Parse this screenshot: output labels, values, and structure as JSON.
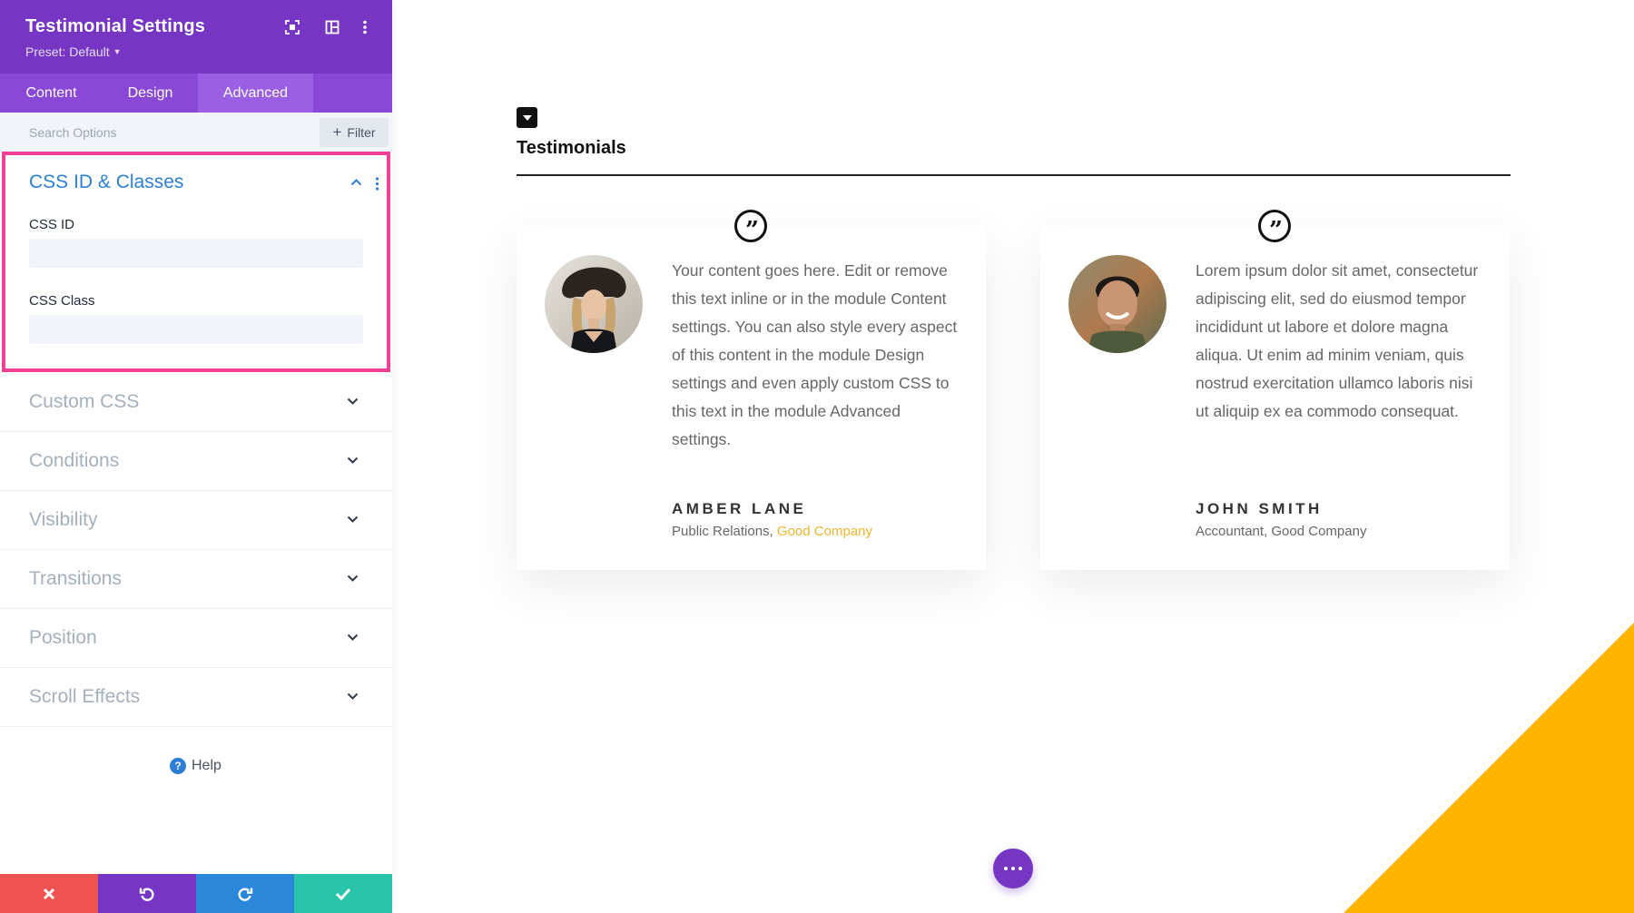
{
  "panel": {
    "title": "Testimonial Settings",
    "preset_label": "Preset: Default",
    "tabs": [
      {
        "label": "Content"
      },
      {
        "label": "Design"
      },
      {
        "label": "Advanced"
      }
    ],
    "active_tab": "Advanced",
    "search": {
      "placeholder": "Search Options",
      "value": ""
    },
    "filter_label": "Filter",
    "open_section": {
      "title": "CSS ID & Classes",
      "fields": [
        {
          "label": "CSS ID",
          "value": ""
        },
        {
          "label": "CSS Class",
          "value": ""
        }
      ]
    },
    "sections": [
      {
        "title": "Custom CSS"
      },
      {
        "title": "Conditions"
      },
      {
        "title": "Visibility"
      },
      {
        "title": "Transitions"
      },
      {
        "title": "Position"
      },
      {
        "title": "Scroll Effects"
      }
    ],
    "help_label": "Help",
    "icons": {
      "focus": "focus-mode-icon",
      "layout": "split-view-icon",
      "more": "more-vertical-icon"
    },
    "colors": {
      "header": "#7636c3",
      "tabs": "#8a48d6",
      "highlight_border": "#ef3f97",
      "accent_blue": "#2c7ed6",
      "cancel": "#ef5350",
      "undo": "#7636c3",
      "redo": "#2b87da",
      "save": "#29c4a9"
    }
  },
  "canvas": {
    "heading": "Testimonials",
    "testimonials": [
      {
        "text": "Your content goes here. Edit or remove this text inline or in the module Content settings. You can also style every aspect of this content in the module Design settings and even apply custom CSS to this text in the module Advanced settings.",
        "author": "AMBER LANE",
        "position": "Public Relations,",
        "company": "Good Company",
        "company_color": "#f0b530"
      },
      {
        "text": "Lorem ipsum dolor sit amet, consectetur adipiscing elit, sed do eiusmod tempor incididunt ut labore et dolore magna aliqua. Ut enim ad minim veniam, quis nostrud exercitation ullamco laboris nisi ut aliquip ex ea commodo consequat.",
        "author": "JOHN SMITH",
        "position": "Accountant, Good Company",
        "company": "",
        "company_color": "#666666"
      }
    ],
    "accent_shape_color": "#ffb400"
  }
}
